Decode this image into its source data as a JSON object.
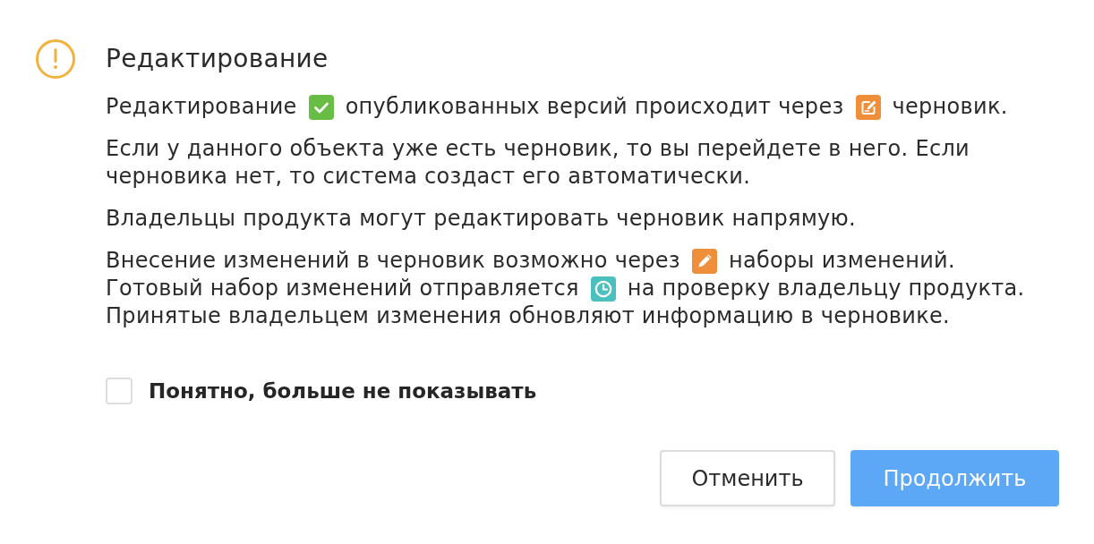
{
  "dialog": {
    "title": "Редактирование",
    "paragraphs": [
      {
        "lines": [
          [
            {
              "kind": "text",
              "text": "Редактирование"
            },
            {
              "kind": "published"
            },
            {
              "kind": "text",
              "text": "опубликованных версий происходит через"
            },
            {
              "kind": "draft"
            },
            {
              "kind": "text",
              "text": "черновик."
            }
          ]
        ]
      },
      {
        "lines": [
          [
            {
              "kind": "text",
              "text": "Если у данного объекта уже есть черновик, то вы перейдете в него. Если черновика нет, то система создаст его автоматически."
            }
          ]
        ]
      },
      {
        "lines": [
          [
            {
              "kind": "text",
              "text": "Владельцы продукта могут редактировать черновик напрямую."
            }
          ]
        ]
      },
      {
        "lines": [
          [
            {
              "kind": "text",
              "text": "Внесение изменений в черновик возможно через"
            },
            {
              "kind": "changeset"
            },
            {
              "kind": "text",
              "text": "наборы изменений."
            }
          ],
          [
            {
              "kind": "text",
              "text": "Готовый набор изменений отправляется"
            },
            {
              "kind": "review"
            },
            {
              "kind": "text",
              "text": "на проверку владельцу продукта."
            }
          ],
          [
            {
              "kind": "text",
              "text": "Принятые владельцем изменения обновляют информацию в черновике."
            }
          ]
        ]
      }
    ],
    "checkbox": {
      "label": "Понятно, больше не показывать",
      "checked": false
    },
    "buttons": [
      {
        "label": "Отменить",
        "kind": "secondary"
      },
      {
        "label": "Продолжить",
        "kind": "primary"
      }
    ]
  }
}
